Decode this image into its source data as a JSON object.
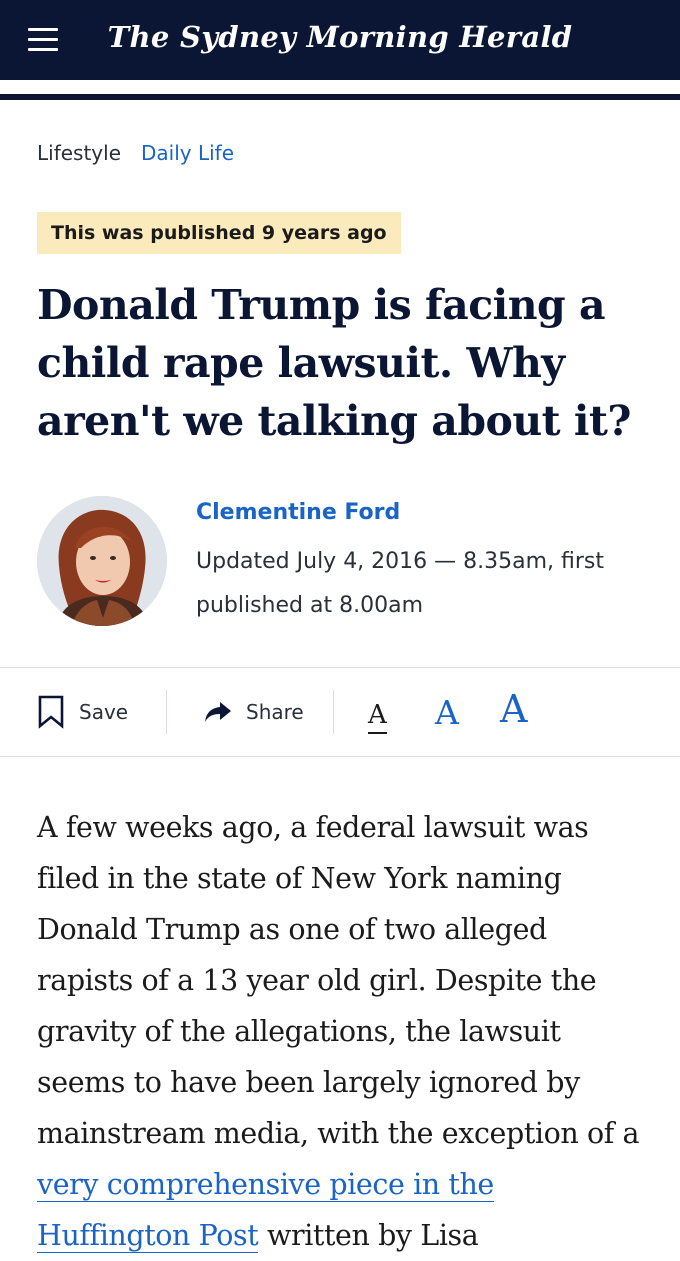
{
  "header": {
    "logo": "The Sydney Morning Herald",
    "menu_icon": "hamburger-menu-icon",
    "background": "#0a1633"
  },
  "breadcrumbs": [
    "Lifestyle",
    "Daily Life"
  ],
  "notice": "This was published 9 years ago",
  "headline": "Donald Trump is facing a child rape lawsuit. Why aren't we talking about it?",
  "byline": {
    "author": "Clementine Ford",
    "dateline_1": "Updated July 4, 2016 — 8.35am, first",
    "dateline_2": "published at 8.00am"
  },
  "toolbar": {
    "save_label": "Save",
    "save_icon": "bookmark-icon",
    "share_label": "Share",
    "share_icon": "share-arrow-icon",
    "font_sizes": [
      "A",
      "A",
      "A"
    ]
  },
  "article": {
    "p1_before": "A few weeks ago, a federal lawsuit was filed in the state of New York naming Donald Trump as one of two alleged rapists of a 13 year old girl. Despite the gravity of the allegations, the lawsuit seems to have been largely ignored by mainstream media, with the exception of a ",
    "p1_link": "very comprehensive piece in the Huffington Post",
    "p1_after": " written by Lisa"
  },
  "colors": {
    "navy": "#0a1633",
    "link_blue": "#1a63c7",
    "notice_bg": "#fbeabb"
  }
}
